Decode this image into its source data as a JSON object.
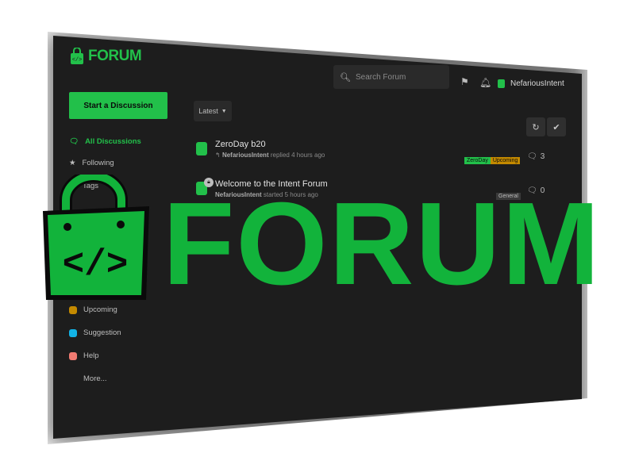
{
  "brand": {
    "name": "FORUM",
    "color": "#22c04a"
  },
  "header": {
    "search_placeholder": "Search Forum",
    "icons": [
      "flag-icon",
      "bell-icon"
    ],
    "username": "NefariousIntent"
  },
  "sidebar": {
    "start_label": "Start a Discussion",
    "items": [
      {
        "label": "All Discussions",
        "icon": "discussions-icon"
      },
      {
        "label": "Following",
        "icon": "star-icon"
      },
      {
        "label": "Tags",
        "icon": "tags-icon"
      }
    ],
    "tags": [
      {
        "label": "Upcoming",
        "color": "#c48a00"
      },
      {
        "label": "Suggestion",
        "color": "#12b3e6"
      },
      {
        "label": "Help",
        "color": "#f17b72"
      }
    ],
    "more_label": "More..."
  },
  "toolbar": {
    "sort_label": "Latest",
    "refresh_icon": "refresh-icon",
    "mark_read_icon": "check-icon"
  },
  "discussions": [
    {
      "title": "ZeroDay b20",
      "author": "NefariousIntent",
      "action": "replied",
      "time": "4 hours ago",
      "tags": [
        {
          "label": "ZeroDay",
          "bg": "#22c04a",
          "fg": "#0b0b0b"
        },
        {
          "label": "Upcoming",
          "bg": "#c48a00",
          "fg": "#0b0b0b"
        }
      ],
      "replies": "3"
    },
    {
      "title": "Welcome to the Intent Forum",
      "author": "NefariousIntent",
      "action": "started",
      "time": "5 hours ago",
      "locked": true,
      "tags": [
        {
          "label": "General",
          "bg": "#3a3a3a",
          "fg": "#bdbdbd"
        }
      ],
      "replies": "0"
    }
  ],
  "overlay": {
    "text": "FORUM",
    "color": "#12b33b"
  }
}
